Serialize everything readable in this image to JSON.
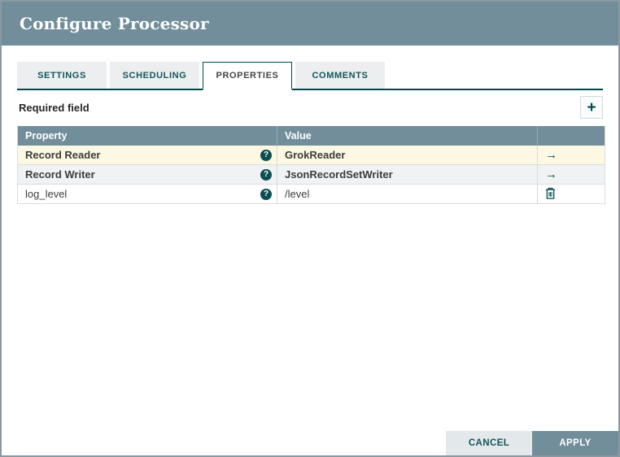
{
  "dialog": {
    "title": "Configure Processor"
  },
  "tabs": [
    {
      "label": "SETTINGS",
      "active": false
    },
    {
      "label": "SCHEDULING",
      "active": false
    },
    {
      "label": "PROPERTIES",
      "active": true
    },
    {
      "label": "COMMENTS",
      "active": false
    }
  ],
  "toolbar": {
    "required_label": "Required field",
    "add_icon": "+"
  },
  "icons": {
    "help": "?",
    "go_arrow": "→"
  },
  "properties_table": {
    "columns": {
      "property": "Property",
      "value": "Value"
    },
    "rows": [
      {
        "property": "Record Reader",
        "value": "GrokReader",
        "action": "navigate"
      },
      {
        "property": "Record Writer",
        "value": "JsonRecordSetWriter",
        "action": "navigate"
      },
      {
        "property": "log_level",
        "value": "/level",
        "action": "delete"
      }
    ]
  },
  "buttons": {
    "cancel": "CANCEL",
    "apply": "APPLY"
  },
  "colors": {
    "header_bg": "#728e9b",
    "accent_teal": "#0b4f53",
    "required_row_bg": "#fdf8e3",
    "alt_row_bg": "#f0f2f3",
    "apply_bg": "#728e9b",
    "cancel_bg": "#e3e8ea"
  }
}
